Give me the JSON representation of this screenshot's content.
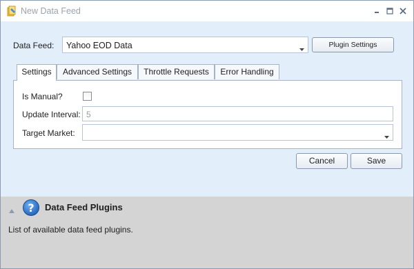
{
  "window": {
    "title": "New Data Feed",
    "icon": "data-feed-app-icon"
  },
  "form": {
    "data_feed_label": "Data Feed:",
    "data_feed_value": "Yahoo EOD Data",
    "plugin_settings_label": "Plugin Settings",
    "tabs": [
      {
        "label": "Settings",
        "active": true
      },
      {
        "label": "Advanced Settings",
        "active": false
      },
      {
        "label": "Throttle Requests",
        "active": false
      },
      {
        "label": "Error Handling",
        "active": false
      }
    ],
    "settings": {
      "is_manual_label": "Is Manual?",
      "is_manual_checked": false,
      "update_interval_label": "Update Interval:",
      "update_interval_value": "5",
      "target_market_label": "Target Market:",
      "target_market_value": ""
    },
    "cancel_label": "Cancel",
    "save_label": "Save"
  },
  "help": {
    "title": "Data Feed Plugins",
    "description": "List of available data feed plugins.",
    "icon": "question-mark-icon"
  },
  "colors": {
    "content_bg": "#e3eefb",
    "help_bg": "#d4d4d4",
    "help_icon": "#1f6fd1"
  }
}
